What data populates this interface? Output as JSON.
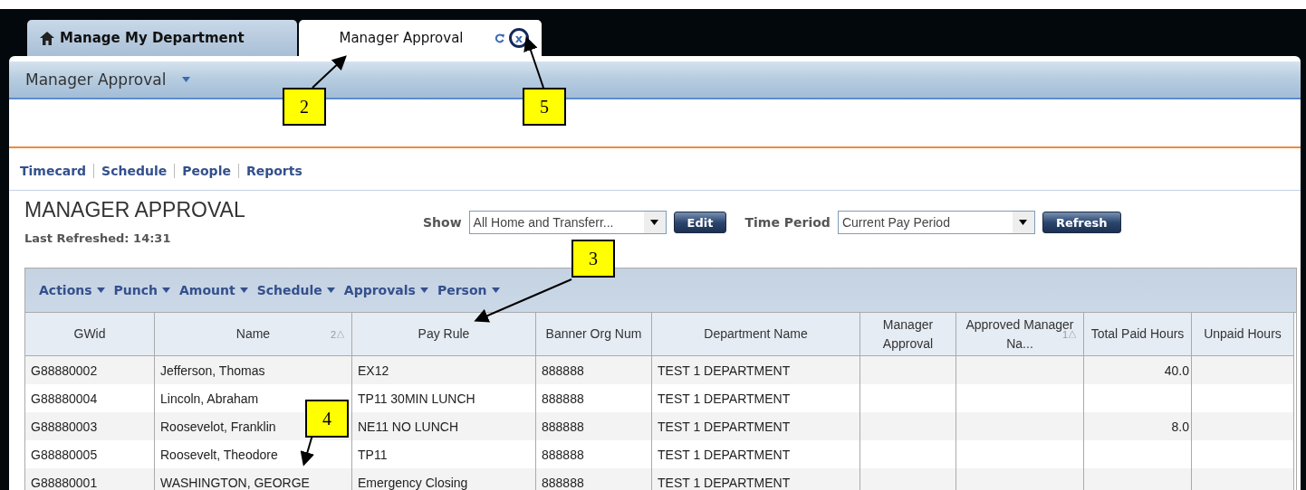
{
  "tabs": [
    {
      "label": "Manage My Department",
      "selected": false
    },
    {
      "label": "Manager Approval",
      "selected": true,
      "close": "x"
    }
  ],
  "header": {
    "title": "Manager Approval"
  },
  "nav_links": [
    "Timecard",
    "Schedule",
    "People",
    "Reports"
  ],
  "page": {
    "title": "MANAGER APPROVAL",
    "last_refreshed": "Last Refreshed: 14:31"
  },
  "filters": [
    {
      "label": "Show",
      "value": "All Home and Transferr...",
      "button": "Edit"
    },
    {
      "label": "Time Period",
      "value": "Current Pay Period",
      "button": "Refresh"
    }
  ],
  "menu": [
    "Actions",
    "Punch",
    "Amount",
    "Schedule",
    "Approvals",
    "Person"
  ],
  "table": {
    "columns": [
      {
        "label": "GWid"
      },
      {
        "label": "Name",
        "sort": "2"
      },
      {
        "label": "Pay Rule"
      },
      {
        "label": "Banner Org Num"
      },
      {
        "label": "Department Name"
      },
      {
        "label": "Manager Approval"
      },
      {
        "label": "Approved Manager Na...",
        "sort": "1"
      },
      {
        "label": "Total Paid Hours"
      },
      {
        "label": "Unpaid Hours"
      }
    ],
    "rows": [
      {
        "cells": [
          "G88880002",
          "Jefferson, Thomas",
          "EX12",
          "888888",
          "TEST 1 DEPARTMENT",
          null,
          null,
          "40.0",
          null
        ]
      },
      {
        "cells": [
          "G88880004",
          "Lincoln, Abraham",
          "TP11 30MIN LUNCH",
          "888888",
          "TEST 1 DEPARTMENT",
          null,
          null,
          null,
          null
        ]
      },
      {
        "cells": [
          "G88880003",
          "Roosevelot, Franklin",
          "NE11 NO LUNCH",
          "888888",
          "TEST 1 DEPARTMENT",
          null,
          null,
          "8.0",
          null
        ]
      },
      {
        "cells": [
          "G88880005",
          "Roosevelt, Theodore",
          "TP11",
          "888888",
          "TEST 1 DEPARTMENT",
          null,
          null,
          null,
          null
        ]
      },
      {
        "cells": [
          "G88880001",
          "WASHINGTON, GEORGE",
          "Emergency Closing",
          "888888",
          "TEST 1 DEPARTMENT",
          null,
          null,
          null,
          null
        ]
      }
    ]
  },
  "callouts": [
    {
      "label": "2"
    },
    {
      "label": "5"
    },
    {
      "label": "3"
    },
    {
      "label": "4"
    }
  ]
}
